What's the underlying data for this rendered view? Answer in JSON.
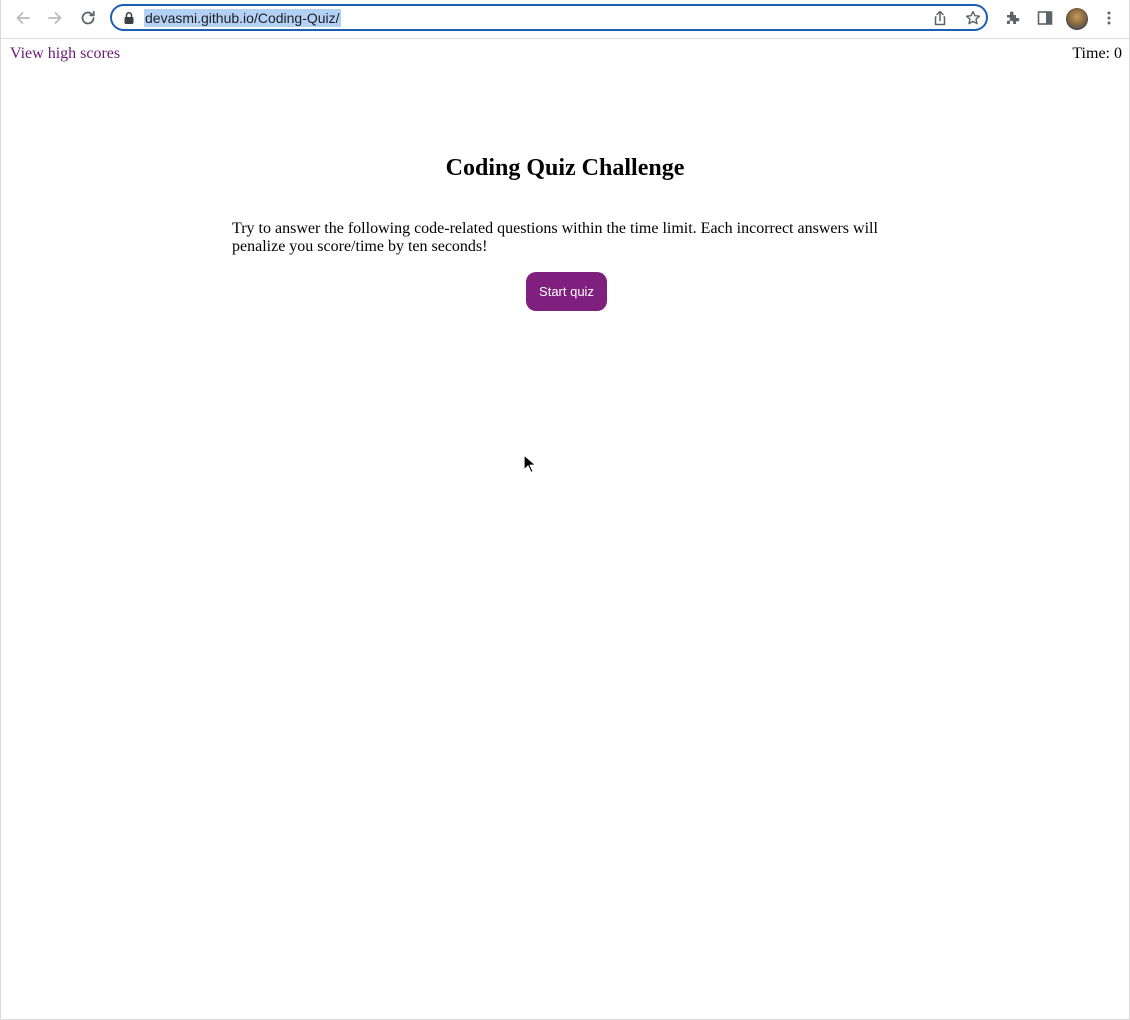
{
  "browser": {
    "url": "devasmi.github.io/Coding-Quiz/",
    "icons": {
      "back": "arrow-left-icon",
      "forward": "arrow-right-icon",
      "reload": "reload-icon",
      "lock": "lock-icon",
      "share": "share-icon",
      "bookmark": "star-icon",
      "extensions": "puzzle-icon",
      "side_panel": "side-panel-icon",
      "menu": "kebab-menu-icon"
    },
    "colors": {
      "omnibox_border": "#1a5fb4",
      "url_selection": "#b3d0f5"
    }
  },
  "page": {
    "high_scores_link": "View high scores",
    "timer_label": "Time:",
    "timer_value": "0",
    "title": "Coding Quiz Challenge",
    "intro": "Try to answer the following code-related questions within the time limit. Each incorrect answers will penalize you score/time by ten seconds!",
    "start_button": "Start quiz",
    "colors": {
      "link": "#6b1a75",
      "button_bg": "#7f1f7e",
      "button_text": "#ffffff"
    }
  }
}
